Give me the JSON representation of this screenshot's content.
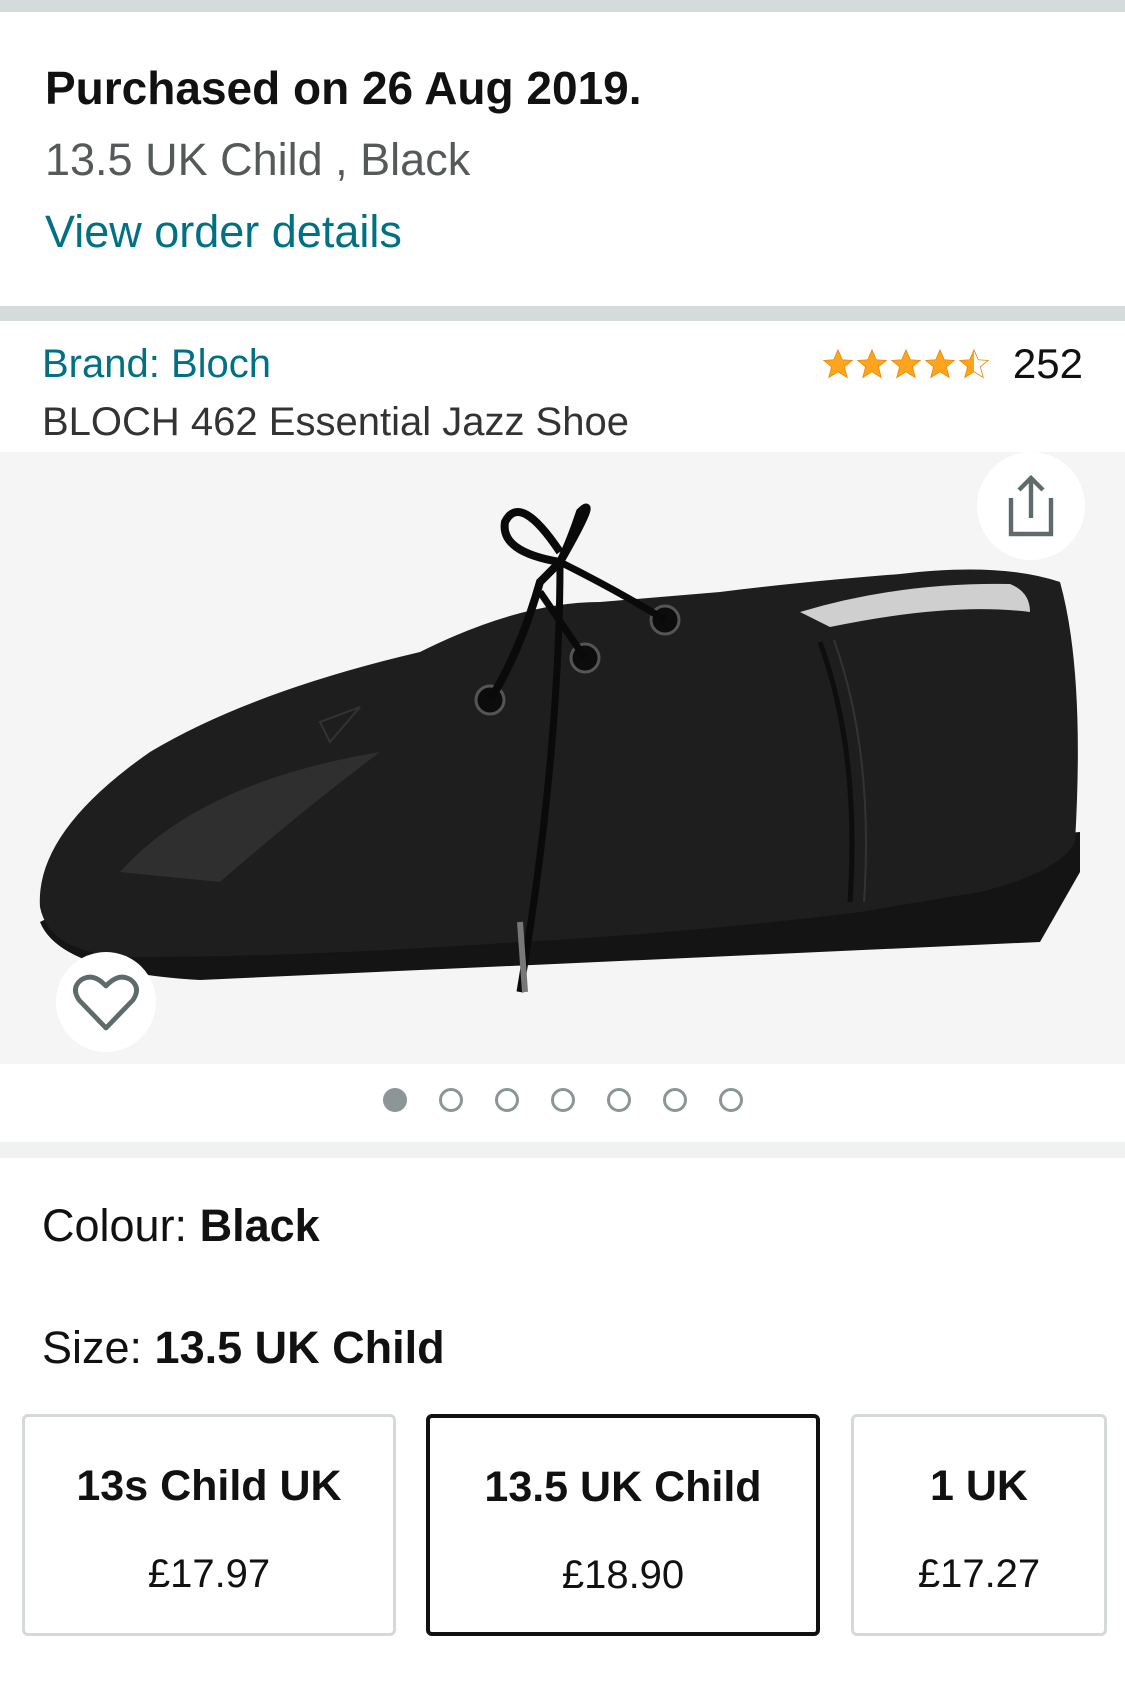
{
  "purchase": {
    "title": "Purchased on 26 Aug 2019.",
    "variant": "13.5 UK Child , Black",
    "link": "View order details"
  },
  "product": {
    "brand": "Brand: Bloch",
    "title": "BLOCH 462 Essential Jazz Shoe",
    "rating": 4.5,
    "rating_count": "252",
    "image_count": 7,
    "active_image": 0
  },
  "colour": {
    "label": "Colour: ",
    "value": "Black"
  },
  "size": {
    "label": "Size: ",
    "value": "13.5 UK Child",
    "options": [
      {
        "name": "13s Child UK",
        "price": "£17.97",
        "selected": false
      },
      {
        "name": "13.5 UK Child",
        "price": "£18.90",
        "selected": true
      },
      {
        "name": "1 UK",
        "price": "£17.27",
        "selected": false
      }
    ]
  },
  "colors": {
    "link": "#007185",
    "star": "#ffa41c",
    "divider": "#d5dbdb"
  },
  "icons": [
    "star-icon",
    "share-icon",
    "heart-icon"
  ]
}
